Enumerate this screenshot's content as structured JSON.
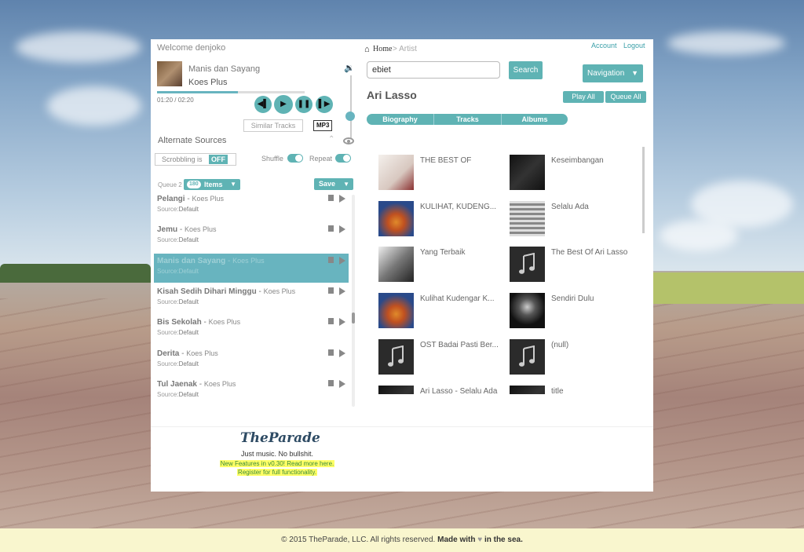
{
  "theme": {
    "accent": "#5fb3b4",
    "link": "#3a9fa8",
    "footer_bg": "#f9f6ce"
  },
  "header": {
    "welcome": "Welcome denjoko",
    "account": "Account",
    "logout": "Logout"
  },
  "breadcrumb": {
    "home": "Home",
    "current": "> Artist"
  },
  "player": {
    "title": "Manis dan Sayang",
    "artist": "Koes Plus",
    "time": "01:20 / 02:20",
    "progress_fraction": 0.55,
    "volume_fraction": 0.75,
    "similar_tracks": "Similar Tracks",
    "format": "MP3",
    "controls": [
      "previous-icon",
      "play-icon",
      "pause-icon",
      "next-icon"
    ]
  },
  "alternate_sources": {
    "label": "Alternate Sources"
  },
  "toggles": {
    "scrobbling_label": "Scrobbling is",
    "scrobbling_state": "OFF",
    "shuffle": "Shuffle",
    "repeat": "Repeat"
  },
  "queue": {
    "label": "Queue 2",
    "count": "180",
    "items_label": "Items",
    "save": "Save",
    "source_prefix": "Source:",
    "items": [
      {
        "title": "Pelangi",
        "artist": "Koes Plus",
        "source": "Default",
        "active": false
      },
      {
        "title": "Jemu",
        "artist": "Koes Plus",
        "source": "Default",
        "active": false
      },
      {
        "title": "Manis dan Sayang",
        "artist": "Koes Plus",
        "source": "Default",
        "active": true
      },
      {
        "title": "Kisah Sedih Dihari Minggu",
        "artist": "Koes Plus",
        "source": "Default",
        "active": false
      },
      {
        "title": "Bis Sekolah",
        "artist": "Koes Plus",
        "source": "Default",
        "active": false
      },
      {
        "title": "Derita",
        "artist": "Koes Plus",
        "source": "Default",
        "active": false
      },
      {
        "title": "Tul Jaenak",
        "artist": "Koes Plus",
        "source": "Default",
        "active": false
      }
    ]
  },
  "search": {
    "value": "ebiet",
    "button": "Search"
  },
  "navigation": {
    "label": "Navigation"
  },
  "artist": {
    "name": "Ari Lasso",
    "play_all": "Play All",
    "queue_all": "Queue All"
  },
  "tabs": [
    "Biography",
    "Tracks",
    "Albums"
  ],
  "albums": [
    {
      "title": "THE BEST OF",
      "cover": "art-white"
    },
    {
      "title": "Keseimbangan",
      "cover": "art-dark"
    },
    {
      "title": "KULIHAT, KUDENG...",
      "cover": "art-colorful"
    },
    {
      "title": "Selalu Ada",
      "cover": "art-stripes"
    },
    {
      "title": "Yang Terbaik",
      "cover": "art-bw"
    },
    {
      "title": "The Best Of Ari Lasso",
      "cover": "music-note-icon"
    },
    {
      "title": "Kulihat Kudengar K...",
      "cover": "art-colorful"
    },
    {
      "title": "Sendiri Dulu",
      "cover": "art-portrait"
    },
    {
      "title": "OST Badai Pasti Ber...",
      "cover": "music-note-icon"
    },
    {
      "title": "(null)",
      "cover": "music-note-icon"
    },
    {
      "title": "Ari Lasso - Selalu Ada",
      "cover": "art-dark"
    },
    {
      "title": "title",
      "cover": "art-dark"
    }
  ],
  "branding": {
    "logo": "TheParade",
    "tagline": "Just music. No bullshit.",
    "promo_1": "New Features in v0.30! Read more here.",
    "promo_2": "Register for full functionality."
  },
  "footer": {
    "copyright": "© 2015 TheParade, LLC. All rights reserved.",
    "made_with": "Made with",
    "heart": "♥",
    "in_the_sea": "in the sea."
  }
}
